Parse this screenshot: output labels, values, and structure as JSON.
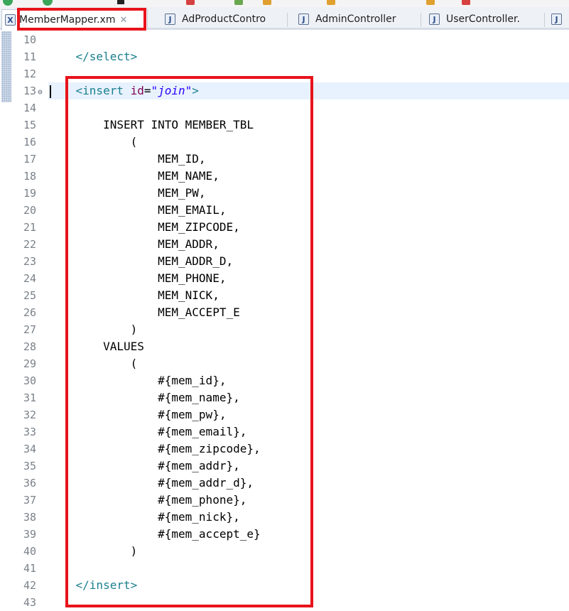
{
  "tabs": [
    {
      "icon": "X",
      "label": "MemberMapper.xm",
      "close": "✕",
      "active": true
    },
    {
      "icon": "J",
      "label": "AdProductContro",
      "active": false
    },
    {
      "icon": "J",
      "label": "AdminController",
      "active": false
    },
    {
      "icon": "J",
      "label": "UserController.",
      "active": false
    },
    {
      "icon": "J",
      "label": "",
      "active": false
    }
  ],
  "editor": {
    "fold_marker": "⊖",
    "lines": [
      {
        "n": "10",
        "segments": []
      },
      {
        "n": "11",
        "segments": [
          {
            "t": "    ",
            "c": ""
          },
          {
            "t": "</select>",
            "c": "tag"
          }
        ]
      },
      {
        "n": "12",
        "segments": []
      },
      {
        "n": "13",
        "segments": [
          {
            "t": "    ",
            "c": ""
          },
          {
            "t": "<insert ",
            "c": "tag"
          },
          {
            "t": "id",
            "c": "attr"
          },
          {
            "t": "=",
            "c": ""
          },
          {
            "t": "\"join\"",
            "c": "str"
          },
          {
            "t": ">",
            "c": "tag"
          }
        ]
      },
      {
        "n": "14",
        "segments": []
      },
      {
        "n": "15",
        "segments": [
          {
            "t": "        INSERT INTO MEMBER_TBL",
            "c": ""
          }
        ]
      },
      {
        "n": "16",
        "segments": [
          {
            "t": "            (",
            "c": ""
          }
        ]
      },
      {
        "n": "17",
        "segments": [
          {
            "t": "                MEM_ID,",
            "c": ""
          }
        ]
      },
      {
        "n": "18",
        "segments": [
          {
            "t": "                MEM_NAME,",
            "c": ""
          }
        ]
      },
      {
        "n": "19",
        "segments": [
          {
            "t": "                MEM_PW,",
            "c": ""
          }
        ]
      },
      {
        "n": "20",
        "segments": [
          {
            "t": "                MEM_EMAIL,",
            "c": ""
          }
        ]
      },
      {
        "n": "21",
        "segments": [
          {
            "t": "                MEM_ZIPCODE,",
            "c": ""
          }
        ]
      },
      {
        "n": "22",
        "segments": [
          {
            "t": "                MEM_ADDR,",
            "c": ""
          }
        ]
      },
      {
        "n": "23",
        "segments": [
          {
            "t": "                MEM_ADDR_D,",
            "c": ""
          }
        ]
      },
      {
        "n": "24",
        "segments": [
          {
            "t": "                MEM_PHONE,",
            "c": ""
          }
        ]
      },
      {
        "n": "25",
        "segments": [
          {
            "t": "                MEM_NICK,",
            "c": ""
          }
        ]
      },
      {
        "n": "26",
        "segments": [
          {
            "t": "                MEM_ACCEPT_E",
            "c": ""
          }
        ]
      },
      {
        "n": "27",
        "segments": [
          {
            "t": "            )",
            "c": ""
          }
        ]
      },
      {
        "n": "28",
        "segments": [
          {
            "t": "        VALUES",
            "c": ""
          }
        ]
      },
      {
        "n": "29",
        "segments": [
          {
            "t": "            (",
            "c": ""
          }
        ]
      },
      {
        "n": "30",
        "segments": [
          {
            "t": "                #{mem_id},",
            "c": ""
          }
        ]
      },
      {
        "n": "31",
        "segments": [
          {
            "t": "                #{mem_name},",
            "c": ""
          }
        ]
      },
      {
        "n": "32",
        "segments": [
          {
            "t": "                #{mem_pw},",
            "c": ""
          }
        ]
      },
      {
        "n": "33",
        "segments": [
          {
            "t": "                #{mem_email},",
            "c": ""
          }
        ]
      },
      {
        "n": "34",
        "segments": [
          {
            "t": "                #{mem_zipcode},",
            "c": ""
          }
        ]
      },
      {
        "n": "35",
        "segments": [
          {
            "t": "                #{mem_addr},",
            "c": ""
          }
        ]
      },
      {
        "n": "36",
        "segments": [
          {
            "t": "                #{mem_addr_d},",
            "c": ""
          }
        ]
      },
      {
        "n": "37",
        "segments": [
          {
            "t": "                #{mem_phone},",
            "c": ""
          }
        ]
      },
      {
        "n": "38",
        "segments": [
          {
            "t": "                #{mem_nick},",
            "c": ""
          }
        ]
      },
      {
        "n": "39",
        "segments": [
          {
            "t": "                #{mem_accept_e}",
            "c": ""
          }
        ]
      },
      {
        "n": "40",
        "segments": [
          {
            "t": "            )",
            "c": ""
          }
        ]
      },
      {
        "n": "41",
        "segments": []
      },
      {
        "n": "42",
        "segments": [
          {
            "t": "    ",
            "c": ""
          },
          {
            "t": "</insert>",
            "c": "tag"
          }
        ]
      },
      {
        "n": "43",
        "segments": []
      }
    ]
  },
  "colors": {
    "highlight": "#e8131b",
    "current_line": "#e8f2fe",
    "tag": "#1a7f8e",
    "attr": "#7f0055",
    "string": "#2a00ff"
  }
}
